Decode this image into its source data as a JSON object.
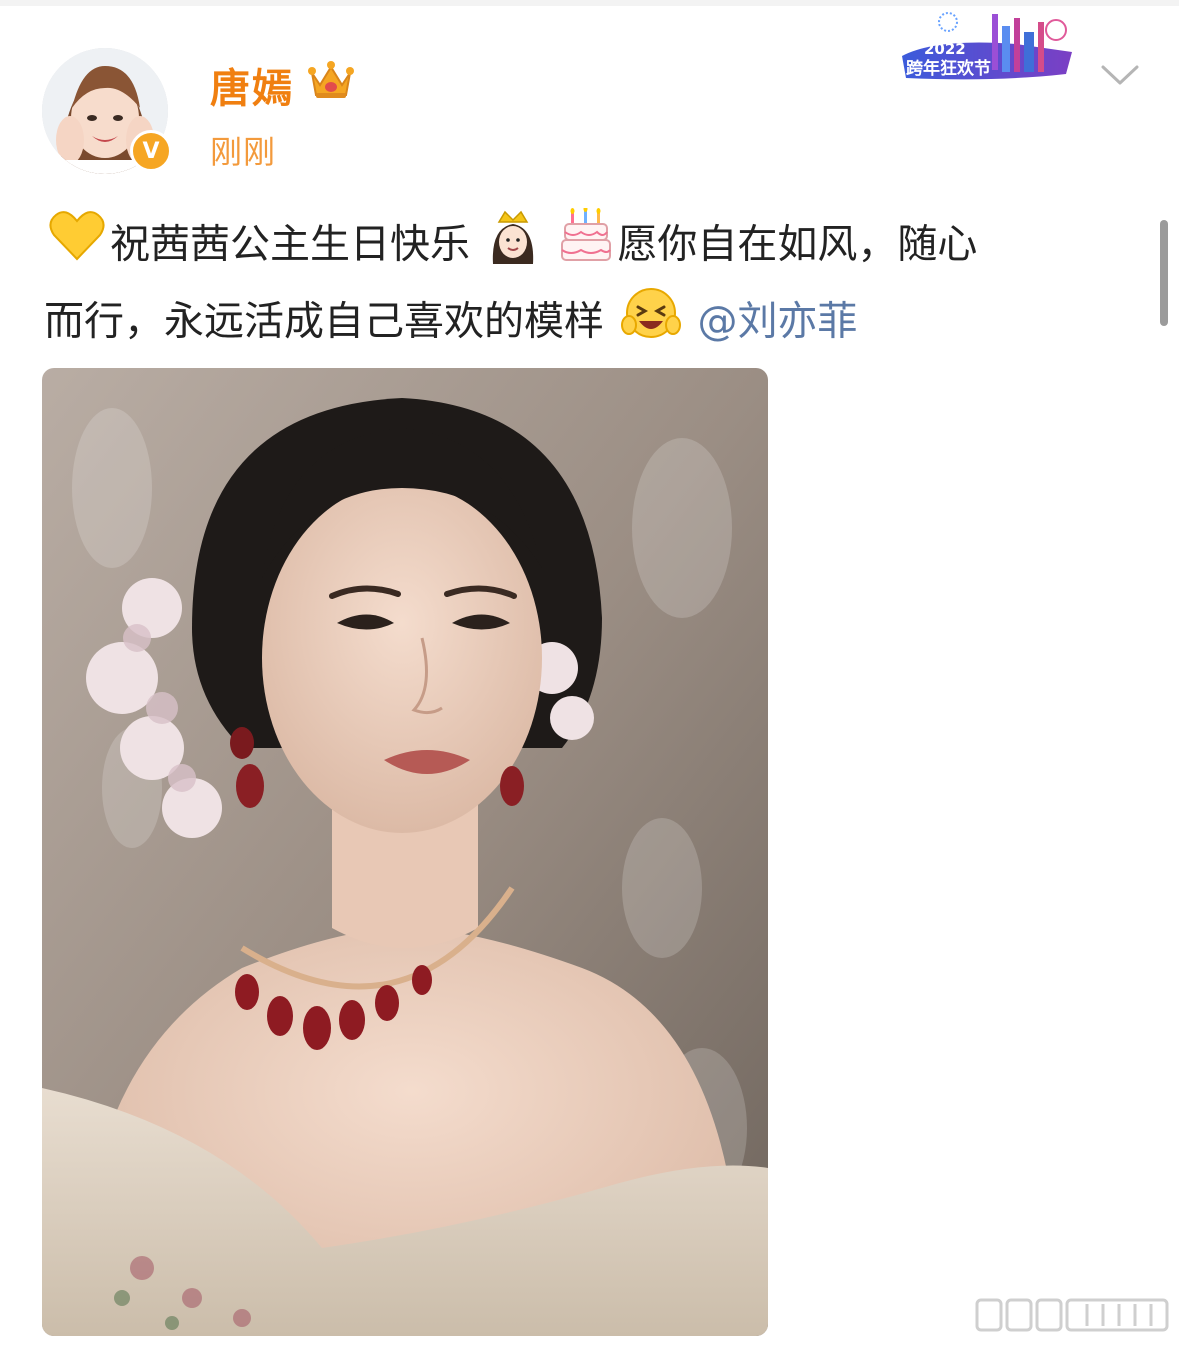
{
  "post": {
    "author": "唐嫣",
    "timestamp": "刚刚",
    "verified_badge": "V",
    "text_part1": "祝茜茜公主生日快乐",
    "text_part2": "愿你自在如风，随心",
    "text_part3": "而行，永远活成自己喜欢的模样",
    "mention": "@刘亦菲",
    "emojis": [
      "yellow-heart-icon",
      "princess-emoji-icon",
      "birthday-cake-icon",
      "laughing-emoji-icon"
    ]
  },
  "event_badge": {
    "year": "2022",
    "title": "跨年狂欢节"
  },
  "colors": {
    "username": "#f07f10",
    "timestamp": "#f39a3c",
    "mention": "#5b79a6",
    "verified": "#f6a623"
  }
}
